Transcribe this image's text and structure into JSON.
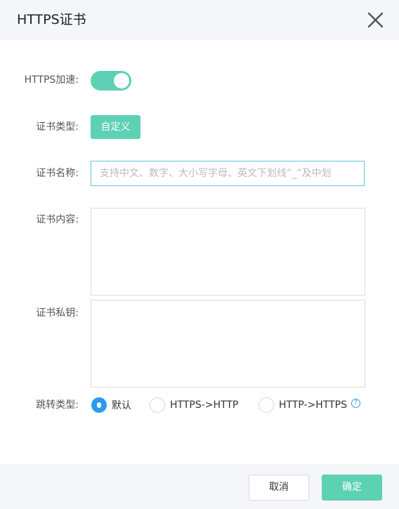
{
  "dialog": {
    "title": "HTTPS证书",
    "close_icon": "close-icon"
  },
  "form": {
    "https_accel": {
      "label": "HTTPS加速:",
      "enabled": true
    },
    "cert_type": {
      "label": "证书类型:",
      "value": "自定义"
    },
    "cert_name": {
      "label": "证书名称:",
      "value": "",
      "placeholder": "支持中文、数字、大小写字母、英文下划线“_”及中划"
    },
    "cert_content": {
      "label": "证书内容:",
      "value": ""
    },
    "cert_key": {
      "label": "证书私钥:",
      "value": ""
    },
    "redirect_type": {
      "label": "跳转类型:",
      "options": [
        "默认",
        "HTTPS->HTTP",
        "HTTP->HTTPS"
      ],
      "selected": "默认",
      "help_icon": "question-circle-icon"
    }
  },
  "footer": {
    "cancel_label": "取消",
    "confirm_label": "确定"
  },
  "colors": {
    "accent": "#5dd1b3",
    "radio_selected": "#2b9af3",
    "header_bg": "#f4f6f9"
  }
}
